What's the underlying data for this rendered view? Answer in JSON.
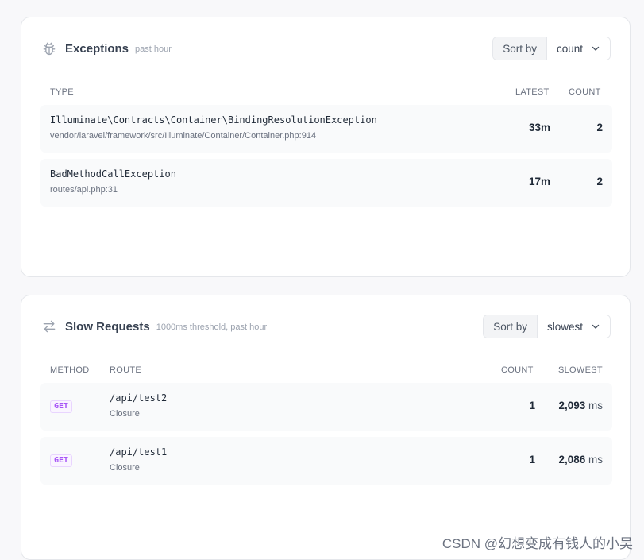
{
  "exceptions": {
    "title": "Exceptions",
    "subtitle": "past hour",
    "sort_label": "Sort by",
    "sort_value": "count",
    "columns": {
      "type": "TYPE",
      "latest": "LATEST",
      "count": "COUNT"
    },
    "rows": [
      {
        "class": "Illuminate\\Contracts\\Container\\BindingResolutionException",
        "location": "vendor/laravel/framework/src/Illuminate/Container/Container.php:914",
        "latest": "33m",
        "count": "2"
      },
      {
        "class": "BadMethodCallException",
        "location": "routes/api.php:31",
        "latest": "17m",
        "count": "2"
      }
    ]
  },
  "slow_requests": {
    "title": "Slow Requests",
    "subtitle": "1000ms threshold, past hour",
    "sort_label": "Sort by",
    "sort_value": "slowest",
    "columns": {
      "method": "METHOD",
      "route": "ROUTE",
      "count": "COUNT",
      "slowest": "SLOWEST"
    },
    "rows": [
      {
        "method": "GET",
        "route": "/api/test2",
        "action": "Closure",
        "count": "1",
        "slowest": "2,093",
        "unit": "ms"
      },
      {
        "method": "GET",
        "route": "/api/test1",
        "action": "Closure",
        "count": "1",
        "slowest": "2,086",
        "unit": "ms"
      }
    ]
  },
  "icons": {
    "exceptions": "bug-icon",
    "slow_requests": "arrows-swap-icon",
    "sort": "chevron-down-icon"
  },
  "watermark": "CSDN @幻想变成有钱人的小吴",
  "colors": {
    "method_badge": "#a855f7",
    "row_bg": "#f9fafb",
    "card_bg": "#ffffff"
  }
}
